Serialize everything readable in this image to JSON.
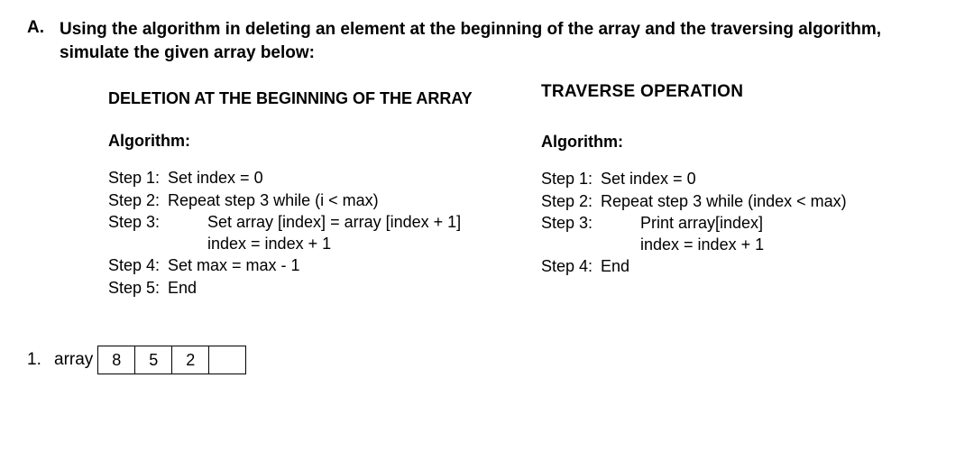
{
  "question": {
    "marker": "A.",
    "text": "Using the algorithm in deleting an element at the beginning of the array and the traversing algorithm, simulate the given array below:"
  },
  "deletion": {
    "title": "DELETION AT THE BEGINNING OF THE ARRAY",
    "subtitle": "Algorithm:",
    "steps": {
      "s1_label": "Step 1:",
      "s1_body": "Set index = 0",
      "s2_label": "Step 2:",
      "s2_body": "Repeat step 3 while (i < max)",
      "s3_label": "Step 3:",
      "s3_body": "Set array [index] = array [index + 1]",
      "s3_sub": "index = index + 1",
      "s4_label": "Step 4:",
      "s4_body": "Set max = max - 1",
      "s5_label": "Step 5:",
      "s5_body": "End"
    }
  },
  "traverse": {
    "title": "TRAVERSE OPERATION",
    "subtitle": "Algorithm:",
    "steps": {
      "s1_label": "Step 1:",
      "s1_body": "Set index = 0",
      "s2_label": "Step 2:",
      "s2_body": "Repeat step 3 while (index < max)",
      "s3_label": "Step 3:",
      "s3_body": "Print array[index]",
      "s3_sub": "index = index + 1",
      "s4_label": "Step 4:",
      "s4_body": "End"
    }
  },
  "problem": {
    "marker": "1.",
    "label": "array",
    "cells": {
      "c0": "8",
      "c1": "5",
      "c2": "2",
      "c3": ""
    }
  }
}
